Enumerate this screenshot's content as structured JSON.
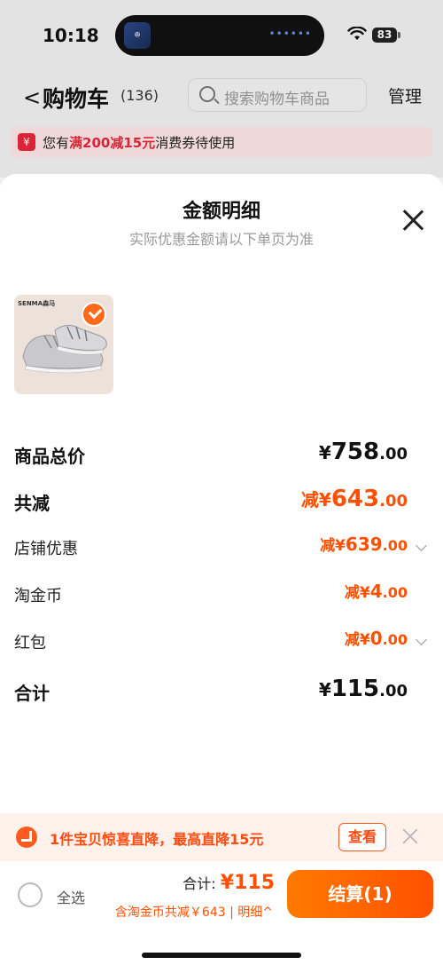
{
  "status_bar": {
    "time": "10:18",
    "battery": "83",
    "island_app": "ꔮ"
  },
  "navbar": {
    "title": "购物车",
    "count": "(136)",
    "search_placeholder": "搜索购物车商品",
    "manage": "管理"
  },
  "coupon_bar": {
    "prefix": "您有",
    "highlight": "满200减15元",
    "suffix": "消费券待使用",
    "icon": "¥"
  },
  "sheet": {
    "title": "金额明细",
    "subtitle": "实际优惠金额请以下单页为准",
    "product": {
      "brand": "SENMA森马"
    },
    "rows": [
      {
        "label": "商品总价",
        "prefix": "¥",
        "int": "758",
        "dec": ".00"
      },
      {
        "label": "共减",
        "prefix": "减¥",
        "int": "643",
        "dec": ".00"
      },
      {
        "label": "店铺优惠",
        "prefix": "减¥",
        "int": "639",
        "dec": ".00"
      },
      {
        "label": "淘金币",
        "prefix": "减¥",
        "int": "4",
        "dec": ".00"
      },
      {
        "label": "红包",
        "prefix": "减¥",
        "int": "0",
        "dec": ".00"
      },
      {
        "label": "合计",
        "prefix": "¥",
        "int": "115",
        "dec": ".00"
      }
    ]
  },
  "promo_bar": {
    "text": "1件宝贝惊喜直降，最高直降15元",
    "button": "查看"
  },
  "checkout": {
    "select_all": "全选",
    "total_label": "合计:",
    "total_amount": "¥115",
    "savings": "含淘金币共减￥643 | 明细^",
    "button": "结算(1)"
  },
  "colors": {
    "accent": "#ff5000",
    "coupon_red": "#e8273b"
  }
}
